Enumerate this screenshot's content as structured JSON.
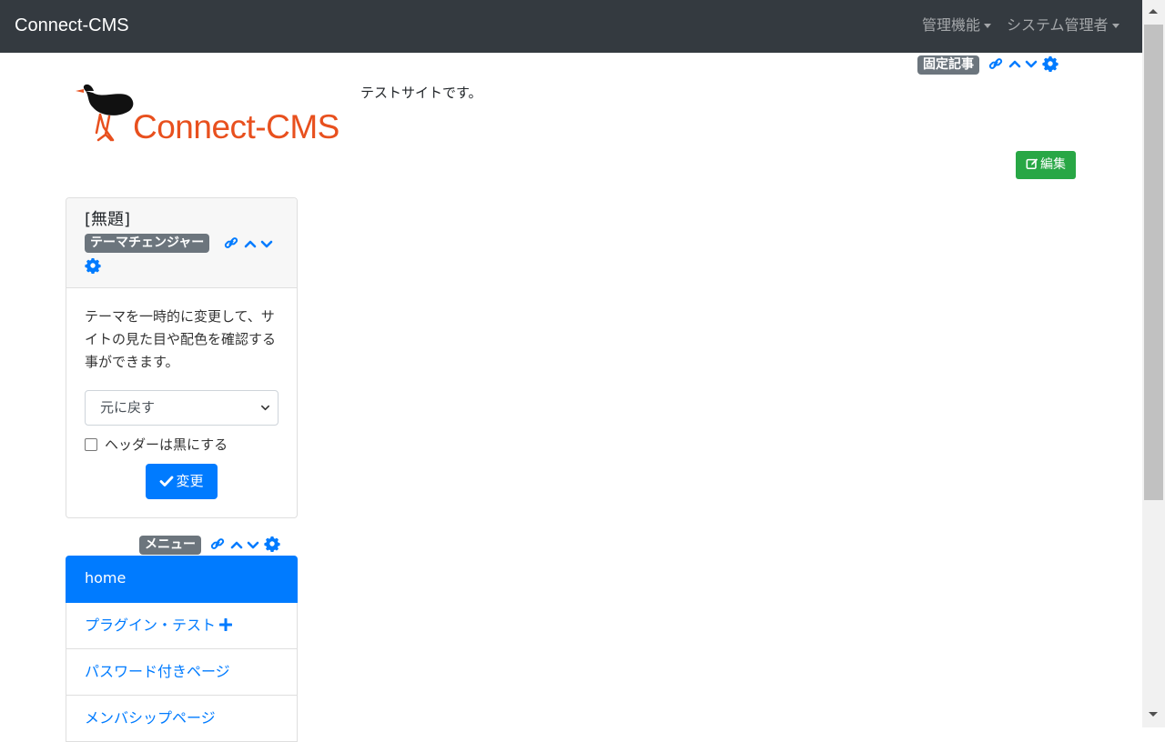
{
  "navbar": {
    "brand": "Connect-CMS",
    "items": [
      {
        "label": "管理機能"
      },
      {
        "label": "システム管理者"
      }
    ]
  },
  "header": {
    "frame_badge": "固定記事",
    "logo_text": "Connect-CMS",
    "text": "テストサイトです。",
    "edit_button": "編集"
  },
  "theme_changer": {
    "title": "[無題]",
    "frame_badge": "テーマチェンジャー",
    "description": "テーマを一時的に変更して、サイトの見た目や配色を確認する事ができます。",
    "select_value": "元に戻す",
    "checkbox_label": "ヘッダーは黒にする",
    "button_label": "変更"
  },
  "menu": {
    "frame_badge": "メニュー",
    "items": [
      {
        "label": "home",
        "active": true
      },
      {
        "label": "プラグイン・テスト",
        "has_plus": true
      },
      {
        "label": "パスワード付きページ"
      },
      {
        "label": "メンバシップページ"
      }
    ]
  },
  "colors": {
    "navbar": "#343a40",
    "primary": "#007bff",
    "success": "#28a745",
    "badge": "#6c757d",
    "logo_accent": "#e8501e"
  },
  "icons": [
    "link-icon",
    "chevron-up-icon",
    "chevron-down-icon",
    "gear-icon",
    "edit-icon",
    "check-icon",
    "plus-icon",
    "caret-down-icon"
  ]
}
